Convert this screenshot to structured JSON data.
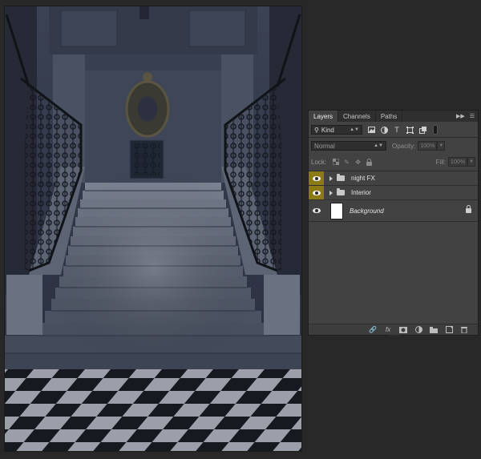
{
  "panel": {
    "tabs": [
      {
        "label": "Layers",
        "active": true
      },
      {
        "label": "Channels",
        "active": false
      },
      {
        "label": "Paths",
        "active": false
      }
    ],
    "filter": {
      "kind_label": "Kind",
      "icons": [
        "image-filter-icon",
        "adjustment-filter-icon",
        "type-filter-icon",
        "shape-filter-icon",
        "smart-object-filter-icon"
      ],
      "type_glyph": "T"
    },
    "blend": {
      "mode": "Normal",
      "opacity_label": "Opacity:",
      "opacity_value": "100%"
    },
    "lock": {
      "label": "Lock:",
      "fill_label": "Fill:",
      "fill_value": "100%"
    },
    "layers": [
      {
        "name": "night FX",
        "type": "group",
        "visible": true,
        "highlight": true
      },
      {
        "name": "Interior",
        "type": "group",
        "visible": true,
        "highlight": true
      },
      {
        "name": "Background",
        "type": "pixel",
        "visible": true,
        "highlight": false,
        "locked": true
      }
    ],
    "footer": {
      "fx_label": "fx"
    }
  },
  "colors": {
    "highlight": "#8c7a16",
    "panel_bg": "#424242",
    "app_bg": "#282828"
  }
}
